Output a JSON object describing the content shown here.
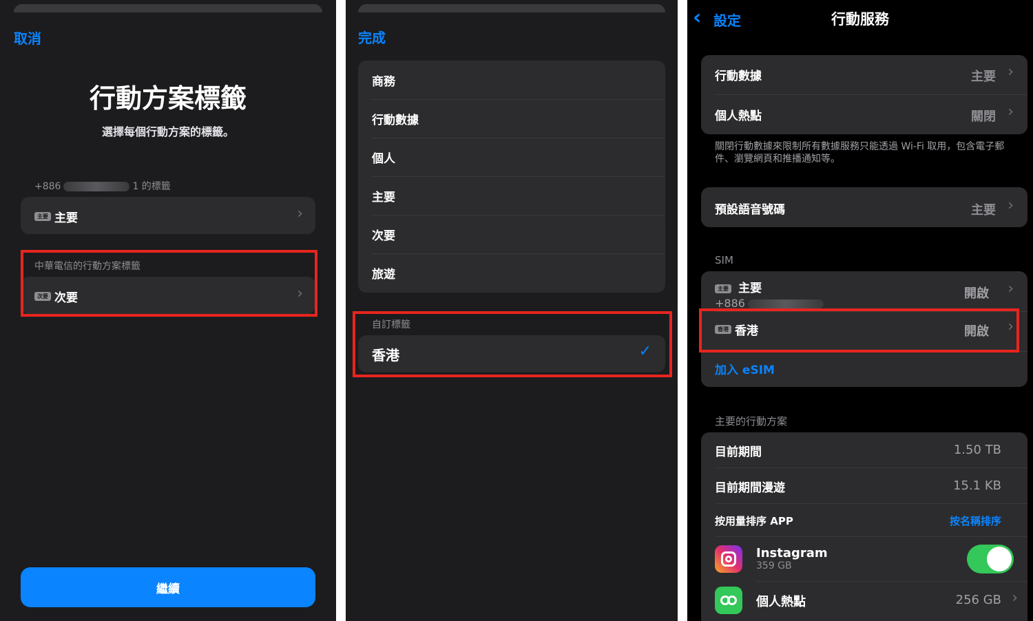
{
  "panel1": {
    "cancel_label": "取消",
    "title": "行動方案標籤",
    "subtitle": "選擇每個行動方案的標籤。",
    "line1_prefix": "+886",
    "line1_suffix": "1 的標籤",
    "line1_tag": "主要",
    "line1_value": "主要",
    "carrier_section": "中華電信的行動方案標籤",
    "line2_tag": "次要",
    "line2_value": "次要",
    "continue_label": "繼續"
  },
  "panel2": {
    "done_label": "完成",
    "options": [
      "商務",
      "行動數據",
      "個人",
      "主要",
      "次要",
      "旅遊"
    ],
    "custom_section": "自訂標籤",
    "custom_value": "香港"
  },
  "panel3": {
    "back_label": "設定",
    "title": "行動服務",
    "cellular_data_label": "行動數據",
    "cellular_data_value": "主要",
    "hotspot_label": "個人熱點",
    "hotspot_value": "關閉",
    "description": "關閉行動數據來限制所有數據服務只能透過 Wi-Fi 取用，包含電子郵件、瀏覽網頁和推播通知等。",
    "voice_label": "預設語音號碼",
    "voice_value": "主要",
    "sim_section": "SIM",
    "sim1_tag": "主要",
    "sim1_name": "主要",
    "sim1_number": "+886",
    "sim1_status": "開啟",
    "sim2_tag": "香港",
    "sim2_name": "香港",
    "sim2_status": "開啟",
    "add_esim": "加入 eSIM",
    "plan_section": "主要的行動方案",
    "current_period_label": "目前期間",
    "current_period_value": "1.50 TB",
    "roaming_label": "目前期間漫遊",
    "roaming_value": "15.1 KB",
    "sort_label": "按用量排序 APP",
    "sort_link": "按名稱排序",
    "apps": [
      {
        "name": "Instagram",
        "usage": "359 GB"
      },
      {
        "name": "個人熱點",
        "usage": "256 GB"
      }
    ]
  }
}
